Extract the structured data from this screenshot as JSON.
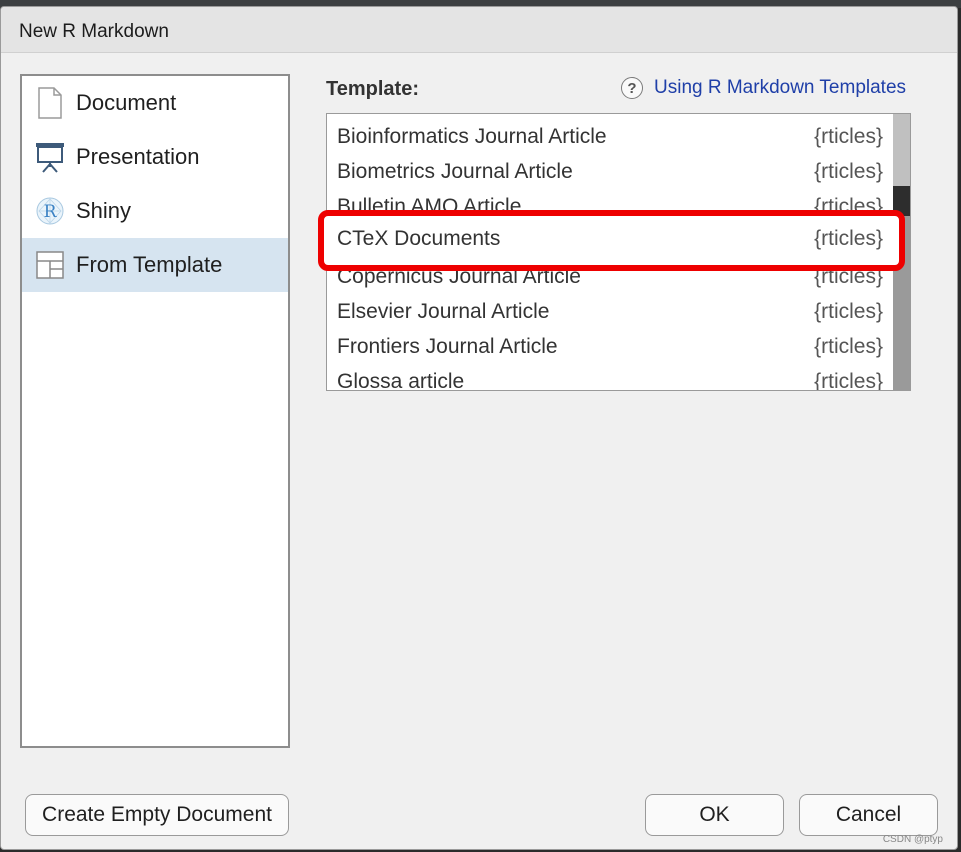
{
  "window": {
    "title": "New R Markdown"
  },
  "sidebar": {
    "items": [
      {
        "label": "Document",
        "icon": "document-icon"
      },
      {
        "label": "Presentation",
        "icon": "presentation-icon"
      },
      {
        "label": "Shiny",
        "icon": "shiny-icon"
      },
      {
        "label": "From Template",
        "icon": "template-icon",
        "selected": true
      }
    ]
  },
  "main": {
    "template_label": "Template:",
    "help_icon": "?",
    "help_link": "Using R Markdown Templates",
    "templates": [
      {
        "name": "Bioinformatics Journal Article",
        "package": "{rticles}"
      },
      {
        "name": "Biometrics Journal Article",
        "package": "{rticles}"
      },
      {
        "name": "Bulletin AMQ Article",
        "package": "{rticles}"
      },
      {
        "name": "CTeX Documents",
        "package": "{rticles}",
        "highlighted": true
      },
      {
        "name": "Copernicus Journal Article",
        "package": "{rticles}"
      },
      {
        "name": "Elsevier Journal Article",
        "package": "{rticles}"
      },
      {
        "name": "Frontiers Journal Article",
        "package": "{rticles}"
      },
      {
        "name": "Glossa article",
        "package": "{rticles}"
      }
    ]
  },
  "footer": {
    "create_empty": "Create Empty Document",
    "ok": "OK",
    "cancel": "Cancel"
  },
  "watermark": "CSDN @ptyp",
  "colors": {
    "selected_bg": "#d6e4f0",
    "link": "#1f3fa8",
    "highlight": "#ee0000"
  }
}
